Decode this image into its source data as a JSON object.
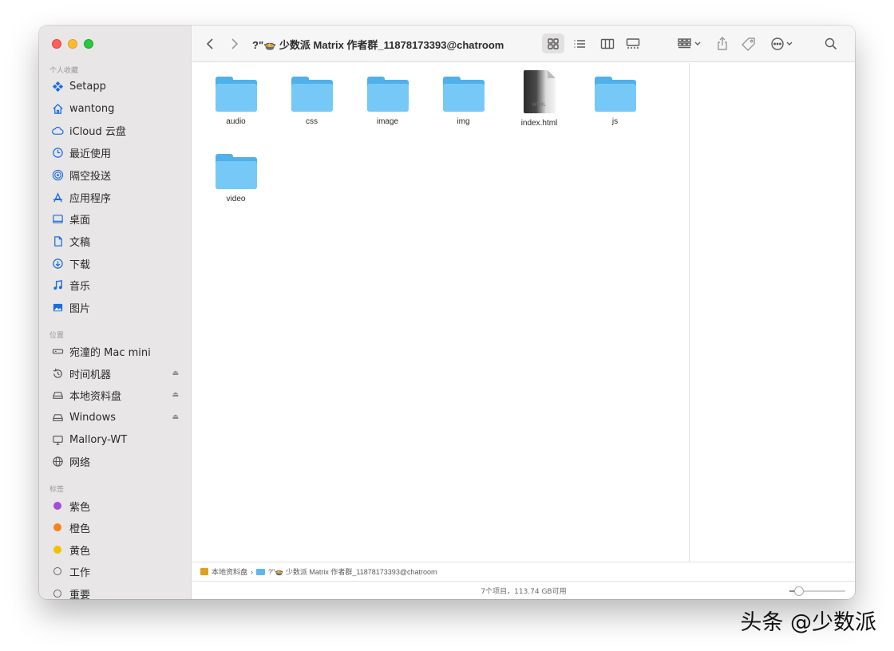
{
  "window": {
    "title": "?\"🍲 少数派 Matrix 作者群_11878173393@chatroom"
  },
  "sidebar": {
    "sections": [
      {
        "label": "个人收藏"
      },
      {
        "label": "位置"
      },
      {
        "label": "标签"
      }
    ],
    "favorites": [
      {
        "label": "Setapp",
        "icon": "setapp-icon"
      },
      {
        "label": "wantong",
        "icon": "home-icon"
      },
      {
        "label": "iCloud 云盘",
        "icon": "cloud-icon"
      },
      {
        "label": "最近使用",
        "icon": "clock-icon"
      },
      {
        "label": "隔空投送",
        "icon": "airdrop-icon"
      },
      {
        "label": "应用程序",
        "icon": "applications-icon"
      },
      {
        "label": "桌面",
        "icon": "desktop-icon"
      },
      {
        "label": "文稿",
        "icon": "document-icon"
      },
      {
        "label": "下载",
        "icon": "download-icon"
      },
      {
        "label": "音乐",
        "icon": "music-icon"
      },
      {
        "label": "图片",
        "icon": "picture-icon"
      }
    ],
    "locations": [
      {
        "label": "宛潼的 Mac mini",
        "icon": "mac-mini-icon"
      },
      {
        "label": "时间机器",
        "icon": "time-machine-icon",
        "eject": "⏏"
      },
      {
        "label": "本地资料盘",
        "icon": "disk-icon",
        "eject": "⏏"
      },
      {
        "label": "Windows",
        "icon": "disk-icon",
        "eject": "⏏"
      },
      {
        "label": "Mallory-WT",
        "icon": "monitor-icon"
      },
      {
        "label": "网络",
        "icon": "network-icon"
      }
    ],
    "tags": [
      {
        "label": "紫色",
        "color": "#a64dd6"
      },
      {
        "label": "橙色",
        "color": "#f5811f"
      },
      {
        "label": "黄色",
        "color": "#f2c200"
      },
      {
        "label": "工作",
        "color": ""
      },
      {
        "label": "重要",
        "color": ""
      }
    ]
  },
  "files": [
    {
      "name": "audio",
      "type": "folder"
    },
    {
      "name": "css",
      "type": "folder"
    },
    {
      "name": "image",
      "type": "folder"
    },
    {
      "name": "img",
      "type": "folder"
    },
    {
      "name": "index.html",
      "type": "html",
      "badge": "HTML"
    },
    {
      "name": "js",
      "type": "folder"
    },
    {
      "name": "video",
      "type": "folder"
    }
  ],
  "pathbar": {
    "items": [
      "本地资料盘",
      "?\"🍲 少数派 Matrix 作者群_11878173393@chatroom"
    ],
    "separator": "›"
  },
  "status": {
    "text": "7个项目，113.74 GB可用",
    "icon_size_slider": 0.17
  },
  "watermark": "头条 @少数派"
}
